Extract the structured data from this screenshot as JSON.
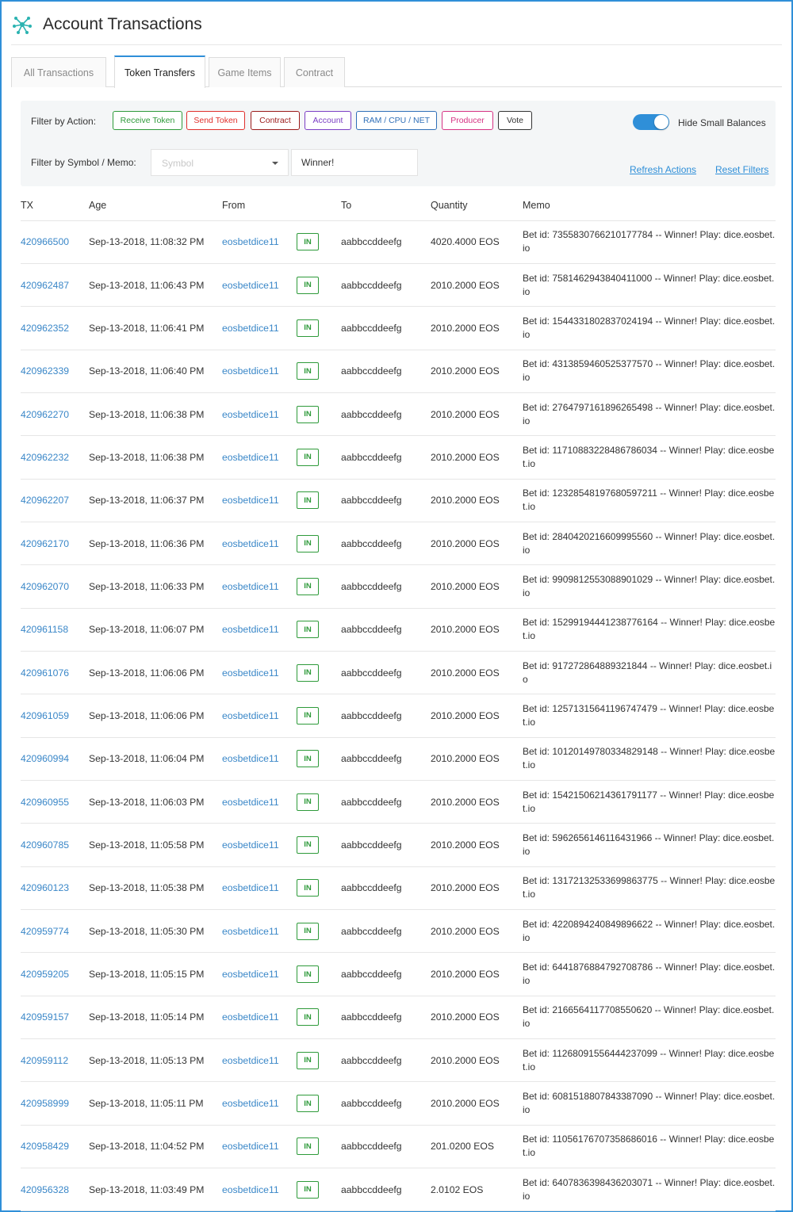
{
  "header": {
    "title": "Account Transactions",
    "logo_icon": "network-nodes-icon"
  },
  "tabs": [
    {
      "label": "All Transactions",
      "active": false
    },
    {
      "label": "Token Transfers",
      "active": true
    },
    {
      "label": "Game Items",
      "active": false
    },
    {
      "label": "Contract",
      "active": false
    }
  ],
  "filters": {
    "action_label": "Filter by Action:",
    "actions": [
      {
        "label": "Receive Token",
        "color": "#2e9a3a"
      },
      {
        "label": "Send Token",
        "color": "#e0302c"
      },
      {
        "label": "Contract",
        "color": "#9b1a1a"
      },
      {
        "label": "Account",
        "color": "#7b3fc4"
      },
      {
        "label": "RAM / CPU / NET",
        "color": "#2f6fb8"
      },
      {
        "label": "Producer",
        "color": "#d63384"
      },
      {
        "label": "Vote",
        "color": "#333333"
      }
    ],
    "hide_small_label": "Hide Small Balances",
    "hide_small_enabled": true,
    "symbol_label": "Filter by Symbol / Memo:",
    "symbol_placeholder": "Symbol",
    "memo_value": "Winner!",
    "refresh_label": "Refresh Actions",
    "reset_label": "Reset Filters"
  },
  "table": {
    "columns": [
      "TX",
      "Age",
      "From",
      "To",
      "Quantity",
      "Memo"
    ],
    "direction_label": "IN",
    "rows": [
      {
        "tx": "420966500",
        "age": "Sep-13-2018, 11:08:32 PM",
        "from": "eosbetdice11",
        "to": "aabbccddeefg",
        "qty": "4020.4000 EOS",
        "memo": "Bet id: 7355830766210177784 -- Winner! Play: dice.eosbet.io"
      },
      {
        "tx": "420962487",
        "age": "Sep-13-2018, 11:06:43 PM",
        "from": "eosbetdice11",
        "to": "aabbccddeefg",
        "qty": "2010.2000 EOS",
        "memo": "Bet id: 7581462943840411000 -- Winner! Play: dice.eosbet.io"
      },
      {
        "tx": "420962352",
        "age": "Sep-13-2018, 11:06:41 PM",
        "from": "eosbetdice11",
        "to": "aabbccddeefg",
        "qty": "2010.2000 EOS",
        "memo": "Bet id: 1544331802837024194 -- Winner! Play: dice.eosbet.io"
      },
      {
        "tx": "420962339",
        "age": "Sep-13-2018, 11:06:40 PM",
        "from": "eosbetdice11",
        "to": "aabbccddeefg",
        "qty": "2010.2000 EOS",
        "memo": "Bet id: 4313859460525377570 -- Winner! Play: dice.eosbet.io"
      },
      {
        "tx": "420962270",
        "age": "Sep-13-2018, 11:06:38 PM",
        "from": "eosbetdice11",
        "to": "aabbccddeefg",
        "qty": "2010.2000 EOS",
        "memo": "Bet id: 2764797161896265498 -- Winner! Play: dice.eosbet.io"
      },
      {
        "tx": "420962232",
        "age": "Sep-13-2018, 11:06:38 PM",
        "from": "eosbetdice11",
        "to": "aabbccddeefg",
        "qty": "2010.2000 EOS",
        "memo": "Bet id: 11710883228486786034 -- Winner! Play: dice.eosbet.io"
      },
      {
        "tx": "420962207",
        "age": "Sep-13-2018, 11:06:37 PM",
        "from": "eosbetdice11",
        "to": "aabbccddeefg",
        "qty": "2010.2000 EOS",
        "memo": "Bet id: 12328548197680597211 -- Winner! Play: dice.eosbet.io"
      },
      {
        "tx": "420962170",
        "age": "Sep-13-2018, 11:06:36 PM",
        "from": "eosbetdice11",
        "to": "aabbccddeefg",
        "qty": "2010.2000 EOS",
        "memo": "Bet id: 2840420216609995560 -- Winner! Play: dice.eosbet.io"
      },
      {
        "tx": "420962070",
        "age": "Sep-13-2018, 11:06:33 PM",
        "from": "eosbetdice11",
        "to": "aabbccddeefg",
        "qty": "2010.2000 EOS",
        "memo": "Bet id: 9909812553088901029 -- Winner! Play: dice.eosbet.io"
      },
      {
        "tx": "420961158",
        "age": "Sep-13-2018, 11:06:07 PM",
        "from": "eosbetdice11",
        "to": "aabbccddeefg",
        "qty": "2010.2000 EOS",
        "memo": "Bet id: 15299194441238776164 -- Winner! Play: dice.eosbet.io"
      },
      {
        "tx": "420961076",
        "age": "Sep-13-2018, 11:06:06 PM",
        "from": "eosbetdice11",
        "to": "aabbccddeefg",
        "qty": "2010.2000 EOS",
        "memo": "Bet id: 917272864889321844 -- Winner! Play: dice.eosbet.io"
      },
      {
        "tx": "420961059",
        "age": "Sep-13-2018, 11:06:06 PM",
        "from": "eosbetdice11",
        "to": "aabbccddeefg",
        "qty": "2010.2000 EOS",
        "memo": "Bet id: 12571315641196747479 -- Winner! Play: dice.eosbet.io"
      },
      {
        "tx": "420960994",
        "age": "Sep-13-2018, 11:06:04 PM",
        "from": "eosbetdice11",
        "to": "aabbccddeefg",
        "qty": "2010.2000 EOS",
        "memo": "Bet id: 10120149780334829148 -- Winner! Play: dice.eosbet.io"
      },
      {
        "tx": "420960955",
        "age": "Sep-13-2018, 11:06:03 PM",
        "from": "eosbetdice11",
        "to": "aabbccddeefg",
        "qty": "2010.2000 EOS",
        "memo": "Bet id: 15421506214361791177 -- Winner! Play: dice.eosbet.io"
      },
      {
        "tx": "420960785",
        "age": "Sep-13-2018, 11:05:58 PM",
        "from": "eosbetdice11",
        "to": "aabbccddeefg",
        "qty": "2010.2000 EOS",
        "memo": "Bet id: 5962656146116431966 -- Winner! Play: dice.eosbet.io"
      },
      {
        "tx": "420960123",
        "age": "Sep-13-2018, 11:05:38 PM",
        "from": "eosbetdice11",
        "to": "aabbccddeefg",
        "qty": "2010.2000 EOS",
        "memo": "Bet id: 13172132533699863775 -- Winner! Play: dice.eosbet.io"
      },
      {
        "tx": "420959774",
        "age": "Sep-13-2018, 11:05:30 PM",
        "from": "eosbetdice11",
        "to": "aabbccddeefg",
        "qty": "2010.2000 EOS",
        "memo": "Bet id: 4220894240849896622 -- Winner! Play: dice.eosbet.io"
      },
      {
        "tx": "420959205",
        "age": "Sep-13-2018, 11:05:15 PM",
        "from": "eosbetdice11",
        "to": "aabbccddeefg",
        "qty": "2010.2000 EOS",
        "memo": "Bet id: 6441876884792708786 -- Winner! Play: dice.eosbet.io"
      },
      {
        "tx": "420959157",
        "age": "Sep-13-2018, 11:05:14 PM",
        "from": "eosbetdice11",
        "to": "aabbccddeefg",
        "qty": "2010.2000 EOS",
        "memo": "Bet id: 2166564117708550620 -- Winner! Play: dice.eosbet.io"
      },
      {
        "tx": "420959112",
        "age": "Sep-13-2018, 11:05:13 PM",
        "from": "eosbetdice11",
        "to": "aabbccddeefg",
        "qty": "2010.2000 EOS",
        "memo": "Bet id: 11268091556444237099 -- Winner! Play: dice.eosbet.io"
      },
      {
        "tx": "420958999",
        "age": "Sep-13-2018, 11:05:11 PM",
        "from": "eosbetdice11",
        "to": "aabbccddeefg",
        "qty": "2010.2000 EOS",
        "memo": "Bet id: 6081518807843387090 -- Winner! Play: dice.eosbet.io"
      },
      {
        "tx": "420958429",
        "age": "Sep-13-2018, 11:04:52 PM",
        "from": "eosbetdice11",
        "to": "aabbccddeefg",
        "qty": "201.0200 EOS",
        "memo": "Bet id: 11056176707358686016 -- Winner! Play: dice.eosbet.io"
      },
      {
        "tx": "420956328",
        "age": "Sep-13-2018, 11:03:49 PM",
        "from": "eosbetdice11",
        "to": "aabbccddeefg",
        "qty": "2.0102 EOS",
        "memo": "Bet id: 6407836398436203071 -- Winner! Play: dice.eosbet.io"
      }
    ]
  }
}
